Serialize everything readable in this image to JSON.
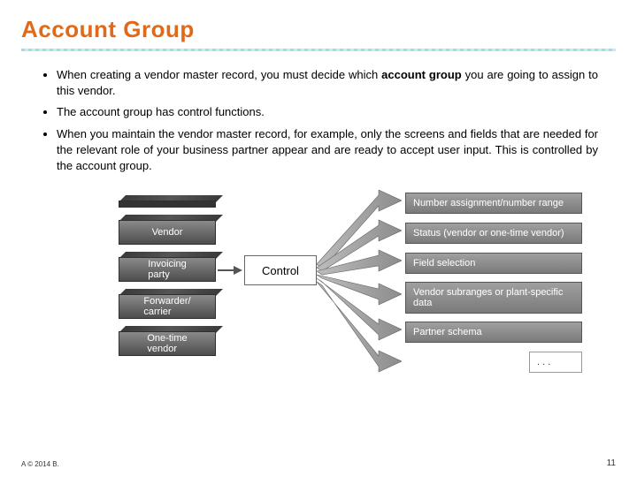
{
  "title": "Account Group",
  "bullets": {
    "b1_pre": "When creating a vendor master record, you must decide which ",
    "b1_strong": "account group",
    "b1_post": " you are going to assign to this vendor.",
    "b2": "The account group has control functions.",
    "b3": "When you maintain the vendor master record, for example, only the screens and fields that are needed for the relevant role of your business partner appear and are ready to accept user input. This is controlled by the account group."
  },
  "stack": {
    "s1": "Vendor",
    "s2": "Invoicing\nparty",
    "s3": "Forwarder/\ncarrier",
    "s4": "One-time\nvendor"
  },
  "control_label": "Control",
  "fan": {
    "f1": "Number assignment/number range",
    "f2": "Status (vendor or one-time vendor)",
    "f3": "Field selection",
    "f4": "Vendor subranges or plant-specific data",
    "f5": "Partner schema",
    "f6": ". . ."
  },
  "footer": {
    "left": "A © 2014 B.",
    "right": "11"
  },
  "colors": {
    "accent": "#e06a1a",
    "divider": "#9adfe6",
    "box_grad_top": "#a0a0a0",
    "box_grad_bot": "#7a7a7a"
  }
}
